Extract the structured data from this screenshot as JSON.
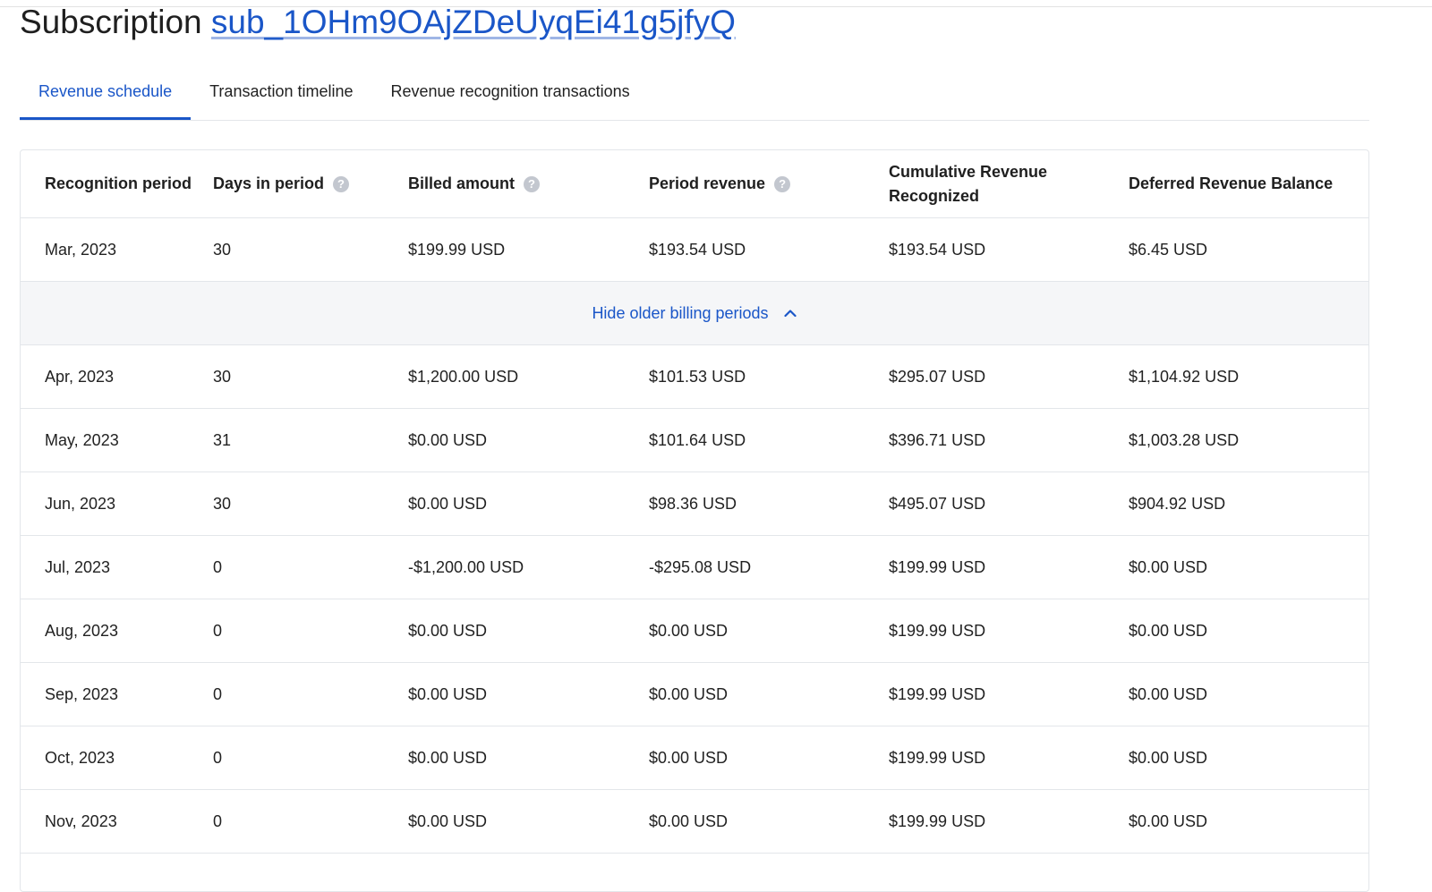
{
  "header": {
    "label": "Subscription",
    "subscription_id": "sub_1OHm9OAjZDeUyqEi41g5jfyQ"
  },
  "tabs": [
    {
      "label": "Revenue schedule",
      "active": true
    },
    {
      "label": "Transaction timeline",
      "active": false
    },
    {
      "label": "Revenue recognition transactions",
      "active": false
    }
  ],
  "table": {
    "columns": [
      {
        "label": "Recognition period",
        "help": false
      },
      {
        "label": "Days in period",
        "help": true
      },
      {
        "label": "Billed amount",
        "help": true
      },
      {
        "label": "Period revenue",
        "help": true
      },
      {
        "label": "Cumulative Revenue Recognized",
        "help": false
      },
      {
        "label": "Deferred Revenue Balance",
        "help": false
      }
    ],
    "first_row": [
      "Mar, 2023",
      "30",
      "$199.99 USD",
      "$193.54 USD",
      "$193.54 USD",
      "$6.45 USD"
    ],
    "toggle_label": "Hide older billing periods",
    "rows": [
      [
        "Apr, 2023",
        "30",
        "$1,200.00 USD",
        "$101.53 USD",
        "$295.07 USD",
        "$1,104.92 USD"
      ],
      [
        "May, 2023",
        "31",
        "$0.00 USD",
        "$101.64 USD",
        "$396.71 USD",
        "$1,003.28 USD"
      ],
      [
        "Jun, 2023",
        "30",
        "$0.00 USD",
        "$98.36 USD",
        "$495.07 USD",
        "$904.92 USD"
      ],
      [
        "Jul, 2023",
        "0",
        "-$1,200.00 USD",
        "-$295.08 USD",
        "$199.99 USD",
        "$0.00 USD"
      ],
      [
        "Aug, 2023",
        "0",
        "$0.00 USD",
        "$0.00 USD",
        "$199.99 USD",
        "$0.00 USD"
      ],
      [
        "Sep, 2023",
        "0",
        "$0.00 USD",
        "$0.00 USD",
        "$199.99 USD",
        "$0.00 USD"
      ],
      [
        "Oct, 2023",
        "0",
        "$0.00 USD",
        "$0.00 USD",
        "$199.99 USD",
        "$0.00 USD"
      ],
      [
        "Nov, 2023",
        "0",
        "$0.00 USD",
        "$0.00 USD",
        "$199.99 USD",
        "$0.00 USD"
      ]
    ]
  },
  "colors": {
    "accent": "#1a56c8",
    "border": "#e3e6ea",
    "toggle_row_bg": "#f5f6f8",
    "help_icon": "#c3c7cf"
  },
  "icons": {
    "help": "question-circle-icon",
    "toggle": "chevron-up-icon"
  }
}
